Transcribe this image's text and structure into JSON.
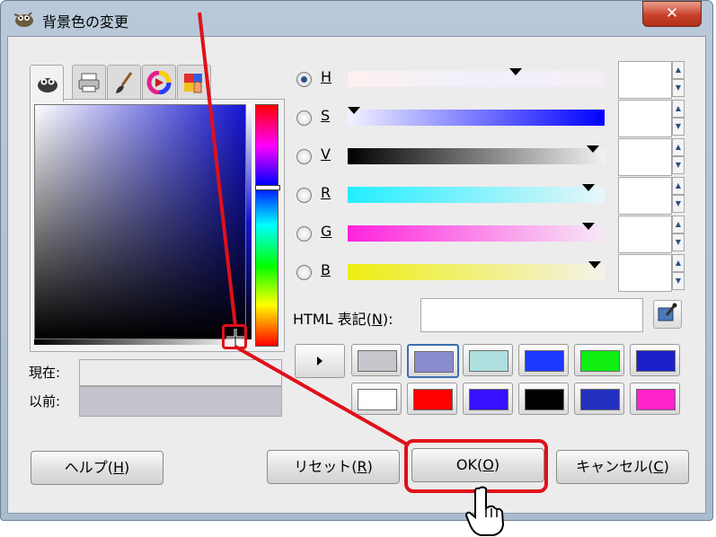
{
  "window": {
    "title": "背景色の変更",
    "close_label": "✕"
  },
  "tabs": [
    {
      "name": "gimp-selector-tab",
      "icon": "wilber-icon",
      "active": true
    },
    {
      "name": "cmyk-tab",
      "icon": "printer-icon",
      "active": false
    },
    {
      "name": "watercolor-tab",
      "icon": "brush-icon",
      "active": false
    },
    {
      "name": "wheel-tab",
      "icon": "color-wheel-icon",
      "active": false
    },
    {
      "name": "palette-tab",
      "icon": "palette-icon",
      "active": false
    }
  ],
  "current_label": "現在:",
  "previous_label": "以前:",
  "colors": {
    "current": "#ececef",
    "previous": "#c4c4ce"
  },
  "channels": [
    {
      "key": "H",
      "label": "H",
      "selected": true
    },
    {
      "key": "S",
      "label": "S",
      "selected": false
    },
    {
      "key": "V",
      "label": "V",
      "selected": false
    },
    {
      "key": "R",
      "label": "R",
      "selected": false
    },
    {
      "key": "G",
      "label": "G",
      "selected": false
    },
    {
      "key": "B",
      "label": "B",
      "selected": false
    }
  ],
  "html_notation": {
    "label_prefix": "HTML 表記(",
    "mnemonic": "N",
    "label_suffix": "):",
    "value": ""
  },
  "history_colors": [
    "#c6c6cc",
    "#8b8bcf",
    "#aee0e0",
    "#1c39ff",
    "#11ee11",
    "#1c20c8",
    "#ffffff",
    "#ff0000",
    "#3810ff",
    "#000000",
    "#2230c0",
    "#ff22cc"
  ],
  "buttons": {
    "help_prefix": "ヘルプ(",
    "help_mnemonic": "H",
    "help_suffix": ")",
    "reset_prefix": "リセット(",
    "reset_mnemonic": "R",
    "reset_suffix": ")",
    "ok_prefix": "OK(",
    "ok_mnemonic": "O",
    "ok_suffix": ")",
    "cancel_prefix": "キャンセル(",
    "cancel_mnemonic": "C",
    "cancel_suffix": ")"
  },
  "annotation_color": "#e0101a"
}
